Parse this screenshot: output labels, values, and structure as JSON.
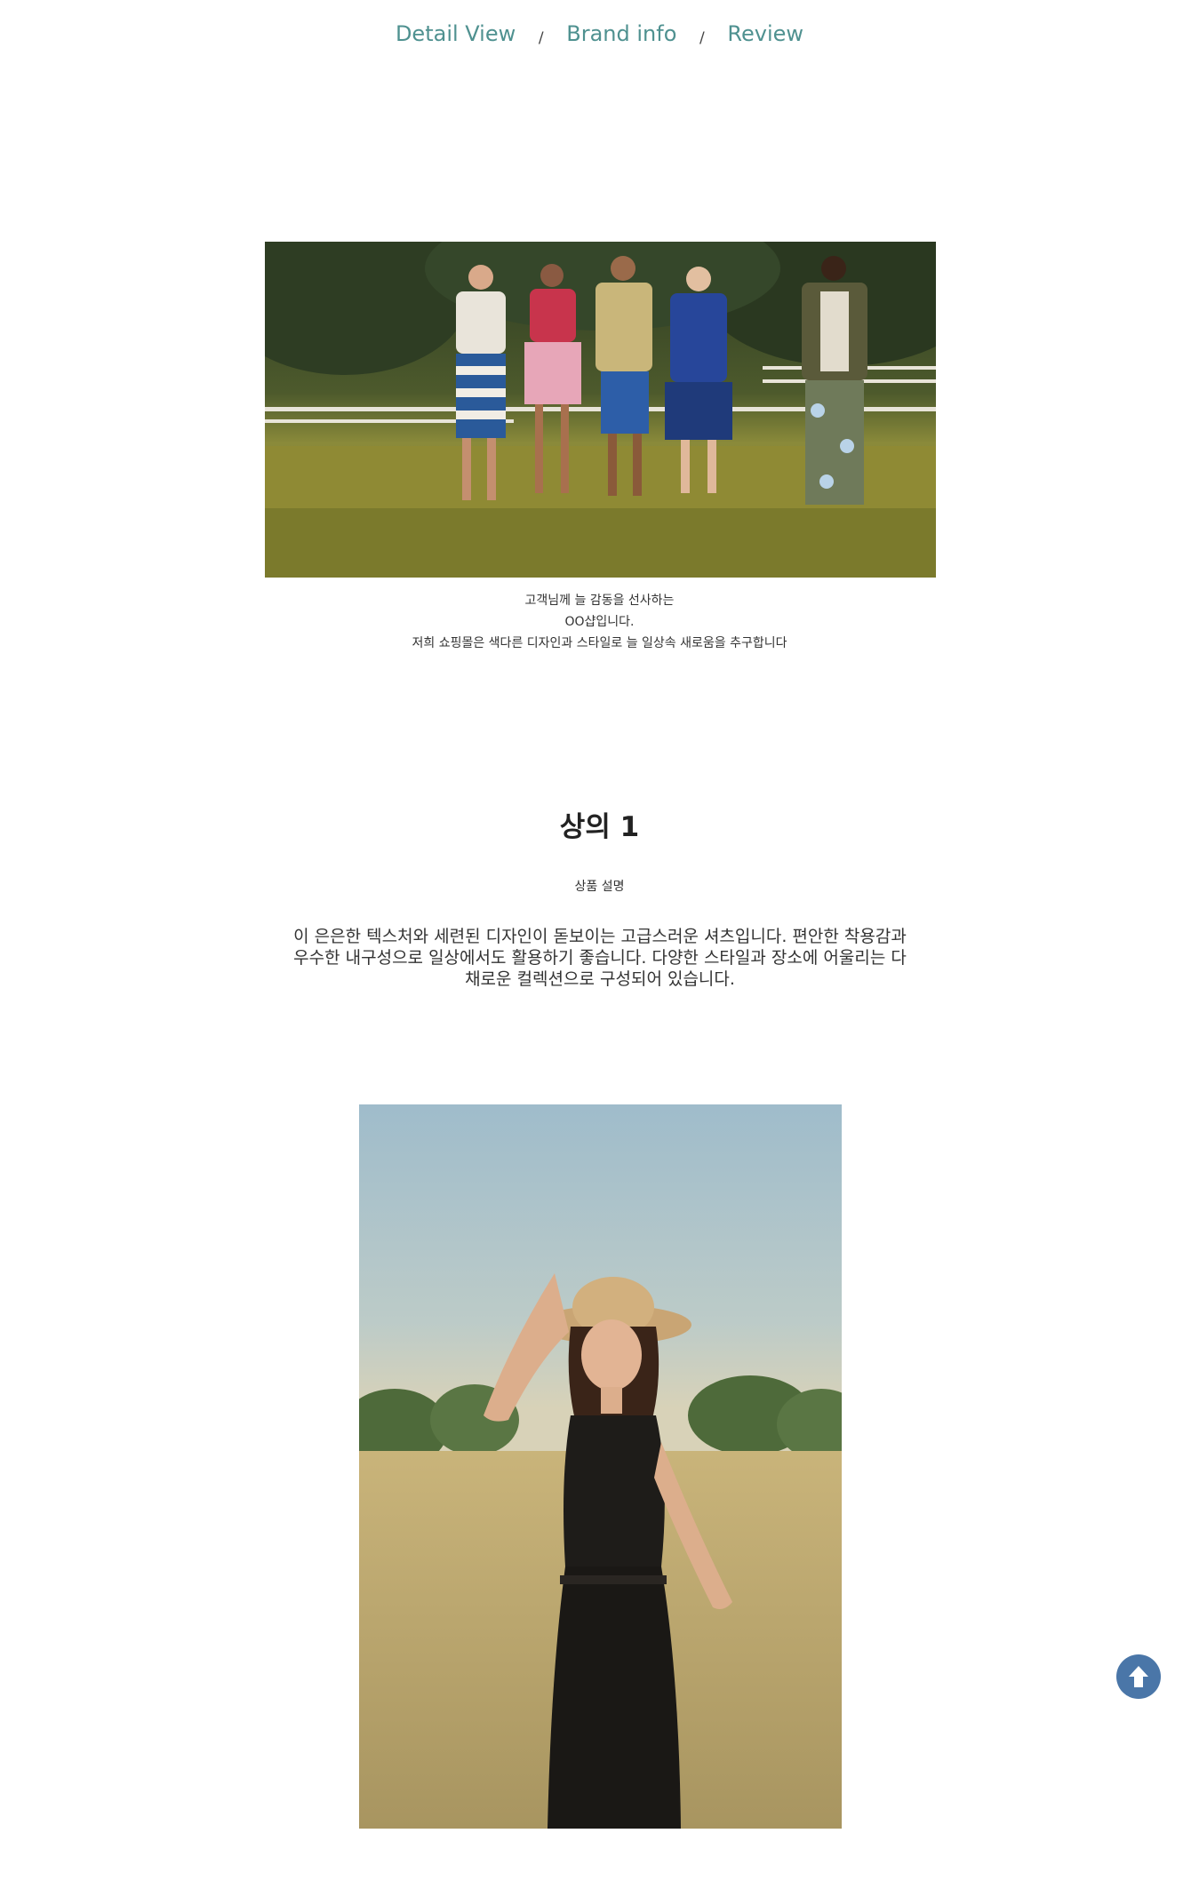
{
  "nav": {
    "tabs": [
      {
        "label": "Detail View"
      },
      {
        "label": "Brand info"
      },
      {
        "label": "Review"
      }
    ],
    "separator": "/"
  },
  "intro": {
    "lines": [
      "고객님께 늘 감동을 선사하는",
      "OO샵입니다.",
      "저희 쇼핑몰은 색다른 디자인과 스타일로 늘 일상속 새로움을 추구합니다"
    ]
  },
  "product": {
    "title": "상의 1",
    "subtitle": "상품 설명",
    "description": "이 은은한 텍스처와 세련된 디자인이 돋보이는 고급스러운 셔츠입니다. 편안한 착용감과 우수한 내구성으로 일상에서도 활용하기 좋습니다. 다양한 스타일과 장소에 어울리는 다채로운 컬렉션으로 구성되어 있습니다."
  },
  "colors": {
    "tab_text": "#4f9190",
    "top_button": "#4a76a8"
  },
  "icons": {
    "scroll_top": "arrow-up-icon"
  }
}
